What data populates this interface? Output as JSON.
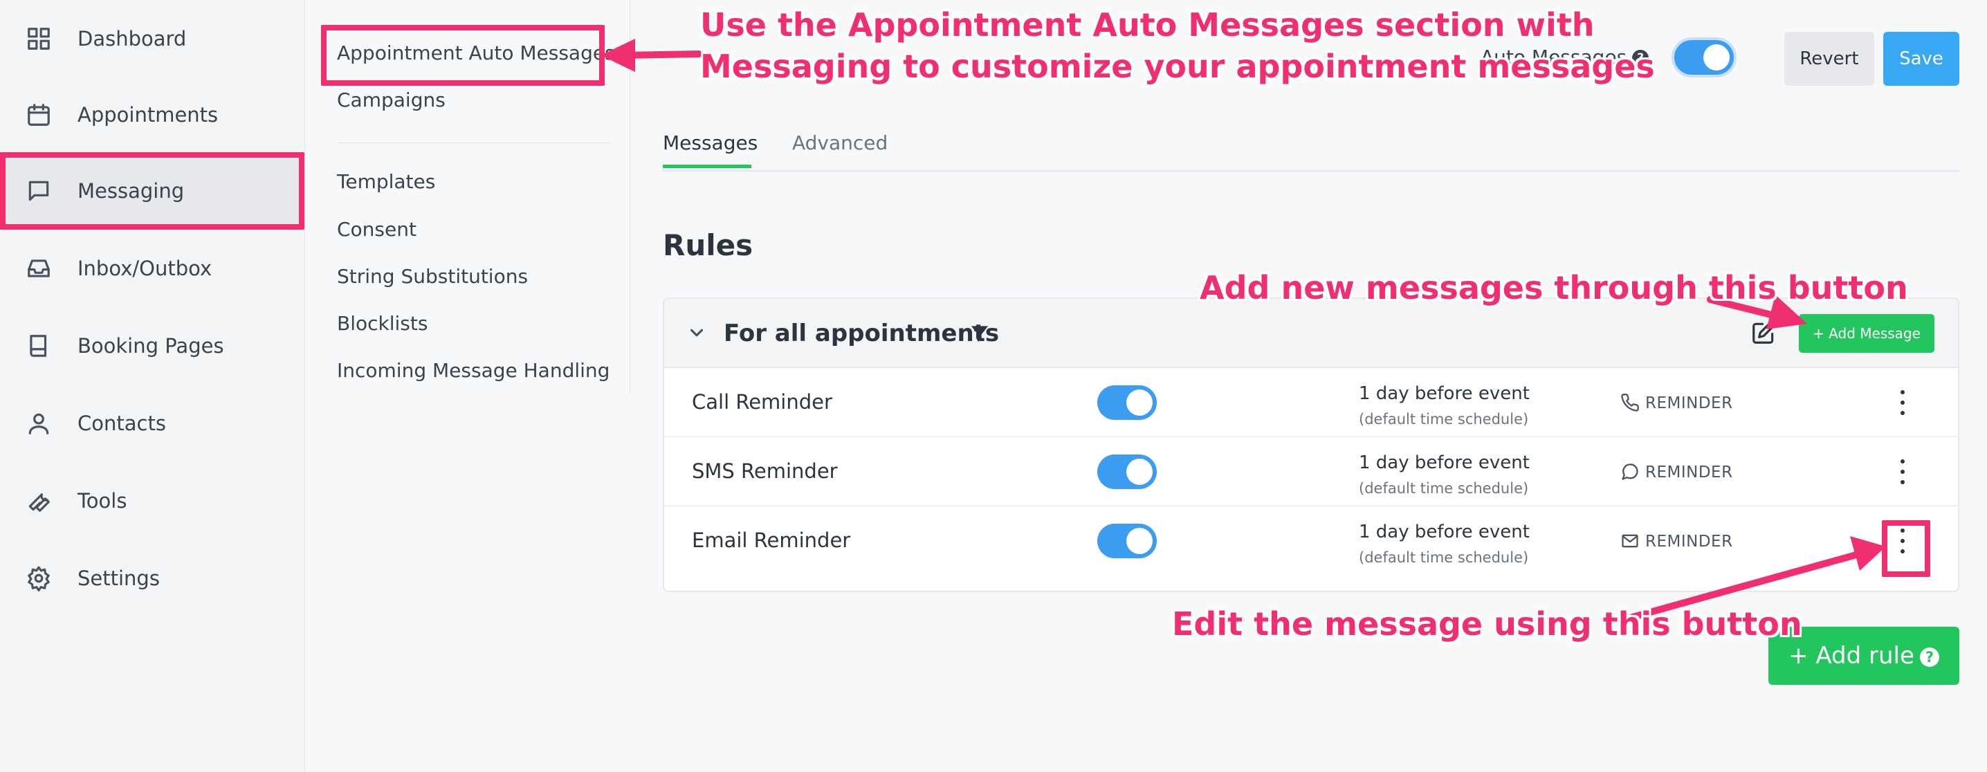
{
  "sidebar": {
    "items": [
      {
        "label": "Dashboard",
        "icon": "dashboard-icon"
      },
      {
        "label": "Appointments",
        "icon": "calendar-icon"
      },
      {
        "label": "Messaging",
        "icon": "message-icon",
        "active": true
      },
      {
        "label": "Inbox/Outbox",
        "icon": "inbox-icon"
      },
      {
        "label": "Booking Pages",
        "icon": "book-icon"
      },
      {
        "label": "Contacts",
        "icon": "user-icon"
      },
      {
        "label": "Tools",
        "icon": "wrench-icon"
      },
      {
        "label": "Settings",
        "icon": "gear-icon"
      }
    ]
  },
  "submenu": {
    "items": [
      "Appointment Auto Messages",
      "Campaigns",
      "Templates",
      "Consent",
      "String Substitutions",
      "Blocklists",
      "Incoming Message Handling"
    ]
  },
  "header": {
    "auto_messages_label": "Auto Messages",
    "help_glyph": "?",
    "auto_messages_enabled": true,
    "revert_label": "Revert",
    "save_label": "Save"
  },
  "tabs": [
    {
      "label": "Messages",
      "active": true
    },
    {
      "label": "Advanced",
      "active": false
    }
  ],
  "rules": {
    "title": "Rules",
    "group": {
      "title": "For all appointments",
      "add_message_label": "+ Add Message",
      "rows": [
        {
          "name": "Call Reminder",
          "enabled": true,
          "schedule": "1 day before event",
          "schedule_note": "(default time schedule)",
          "type": "REMINDER",
          "type_icon": "phone-icon"
        },
        {
          "name": "SMS Reminder",
          "enabled": true,
          "schedule": "1 day before event",
          "schedule_note": "(default time schedule)",
          "type": "REMINDER",
          "type_icon": "chat-bubble-icon"
        },
        {
          "name": "Email Reminder",
          "enabled": true,
          "schedule": "1 day before event",
          "schedule_note": "(default time schedule)",
          "type": "REMINDER",
          "type_icon": "mail-icon"
        }
      ]
    },
    "add_rule_label": "+ Add rule"
  },
  "annotations": {
    "top_line1": "Use the Appointment Auto Messages section with",
    "top_line2": "Messaging to customize your appointment messages",
    "add_new": "Add new messages through this button",
    "edit": "Edit the message using this button",
    "color": "#f0306e"
  },
  "colors": {
    "accent_green": "#22c55e",
    "toggle_blue": "#3b9cf0",
    "save_blue": "#38a8f5"
  }
}
